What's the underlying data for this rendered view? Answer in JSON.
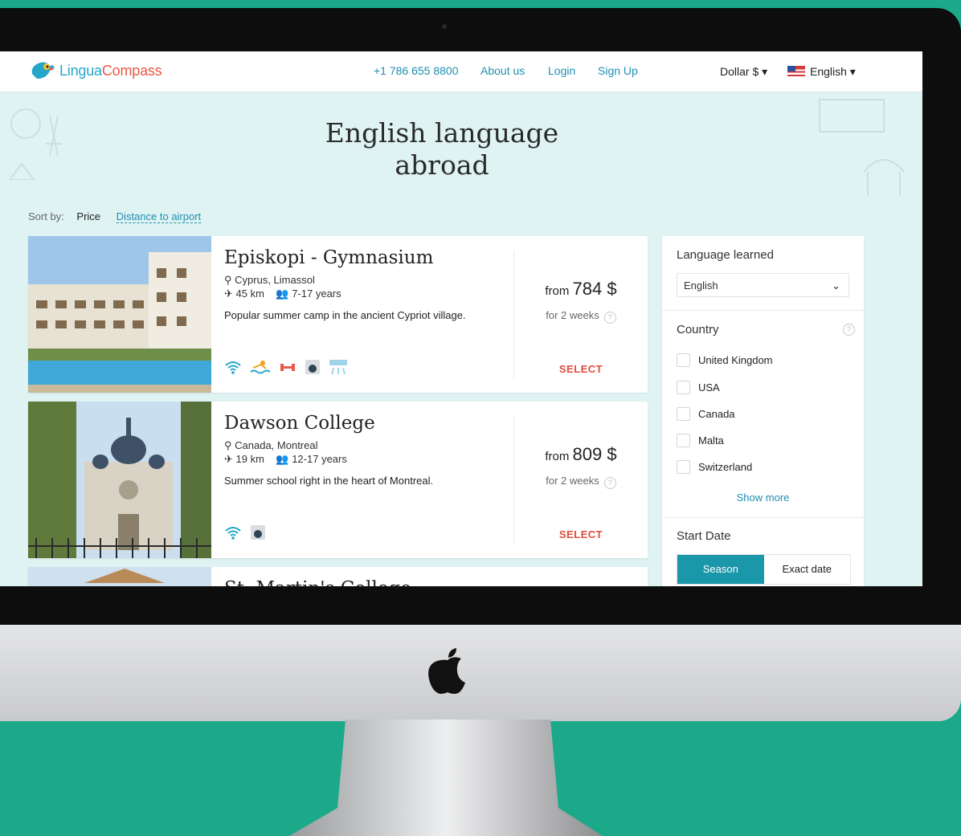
{
  "brand": {
    "part1": "Lingua",
    "part2": "Compass"
  },
  "nav": {
    "phone": "+1 786 655 8800",
    "about": "About us",
    "login": "Login",
    "signup": "Sign Up",
    "currency": "Dollar $ ▾",
    "language": "English ▾"
  },
  "page": {
    "title_line1": "English language",
    "title_line2": "abroad"
  },
  "sort": {
    "label": "Sort by:",
    "price": "Price",
    "distance": "Distance to airport"
  },
  "listings": [
    {
      "name": "Episkopi - Gymnasium",
      "location": "Cyprus, Limassol",
      "distance": "45 km",
      "ages": "7-17 years",
      "description": "Popular summer camp in the ancient Cypriot village.",
      "from": "from",
      "price": "784 $",
      "period": "for 2 weeks",
      "select": "SELECT",
      "amenities": [
        "wifi-icon",
        "pool-icon",
        "gym-icon",
        "laundry-icon",
        "air-conditioning-icon"
      ]
    },
    {
      "name": "Dawson College",
      "location": "Canada, Montreal",
      "distance": "19 km",
      "ages": "12-17 years",
      "description": "Summer school right in the heart of Montreal.",
      "from": "from",
      "price": "809 $",
      "period": "for 2 weeks",
      "select": "SELECT",
      "amenities": [
        "wifi-icon",
        "laundry-icon"
      ]
    },
    {
      "name": "St. Martin's College"
    }
  ],
  "filters": {
    "language_label": "Language learned",
    "language_value": "English",
    "country_label": "Country",
    "countries": [
      "United Kingdom",
      "USA",
      "Canada",
      "Malta",
      "Switzerland"
    ],
    "show_more": "Show more",
    "start_date_label": "Start Date",
    "season": "Season",
    "exact_date": "Exact date"
  },
  "colors": {
    "accent": "#1e8fb0",
    "brand_red": "#e9594a",
    "select_red": "#e04b3c",
    "background_teal": "#1ba98a",
    "screen_bg": "#dff3f3"
  }
}
